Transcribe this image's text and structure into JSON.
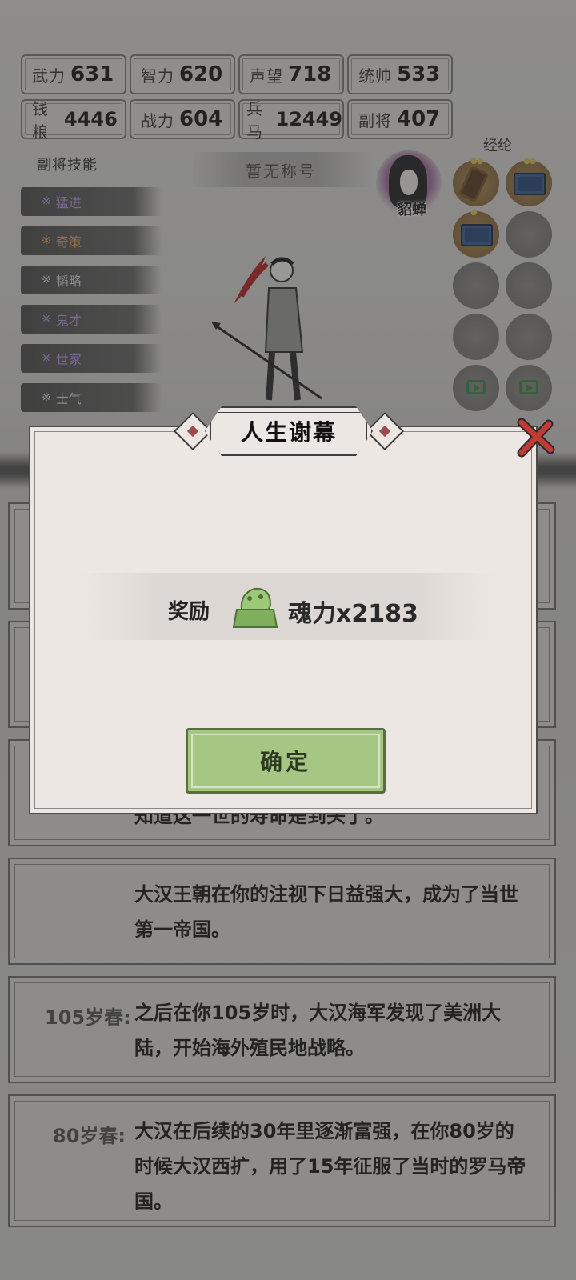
{
  "stats": [
    {
      "label": "武力",
      "value": "631"
    },
    {
      "label": "智力",
      "value": "620"
    },
    {
      "label": "声望",
      "value": "718"
    },
    {
      "label": "统帅",
      "value": "533"
    },
    {
      "label": "钱粮",
      "value": "4446"
    },
    {
      "label": "战力",
      "value": "604"
    },
    {
      "label": "兵马",
      "value": "12449"
    },
    {
      "label": "副将",
      "value": "407"
    }
  ],
  "skills": {
    "title": "副将技能",
    "items": [
      {
        "label": "猛进",
        "color": "#b796e0"
      },
      {
        "label": "奇策",
        "color": "#e3a152"
      },
      {
        "label": "韬略",
        "color": "#d8d8d8"
      },
      {
        "label": "鬼才",
        "color": "#b796e0"
      },
      {
        "label": "世家",
        "color": "#b796e0"
      },
      {
        "label": "士气",
        "color": "#d8d8d8"
      }
    ],
    "mark": "※"
  },
  "title_badge": "暂无称号",
  "companion": {
    "name": "貂蝉"
  },
  "jinglun": {
    "title": "经纶"
  },
  "dialog": {
    "title": "人生谢幕",
    "reward_label": "奖励",
    "reward_value": "魂力x2183",
    "confirm": "确定",
    "close_icon": "close-x-icon"
  },
  "stories": [
    {
      "age": "",
      "text": "知道这一世的寿命是到头了。"
    },
    {
      "age": "",
      "text": "大汉王朝在你的注视下日益强大，成为了当世第一帝国。"
    },
    {
      "age": "105岁春:",
      "text": "之后在你105岁时，大汉海军发现了美洲大陆，开始海外殖民地战略。"
    },
    {
      "age": "80岁春:",
      "text": "大汉在后续的30年里逐渐富强，在你80岁的时候大汉西扩，用了15年征服了当时的罗马帝国。"
    }
  ],
  "colors": {
    "confirm_bg": "#a6c784",
    "close_red": "#c23a34",
    "video_green": "#3d8b4c",
    "seal_green": "#8fbf6a"
  }
}
